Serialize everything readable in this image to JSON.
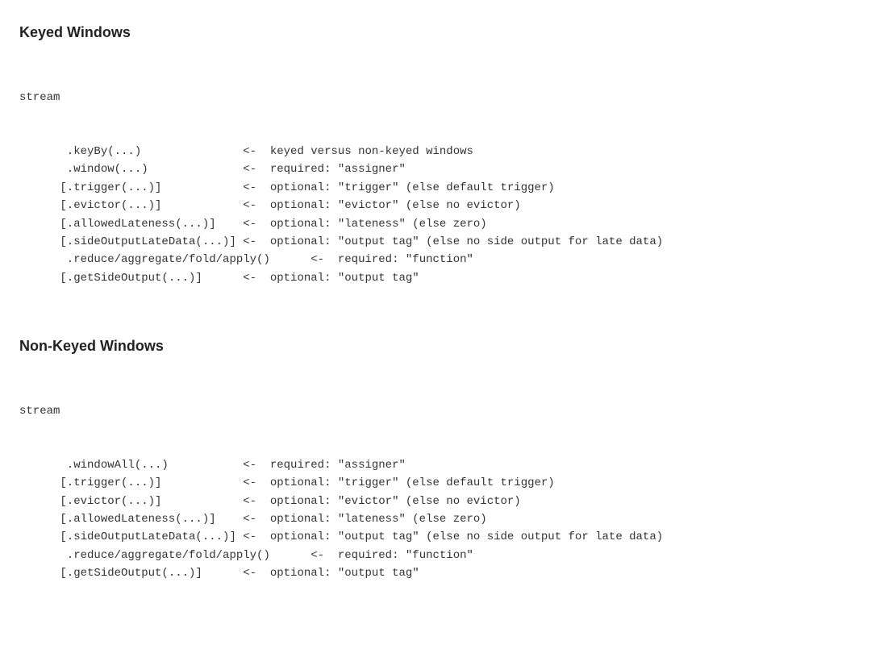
{
  "keyed": {
    "title": "Keyed Windows",
    "stream": "stream",
    "rows": [
      {
        "left": "       .keyBy(...)               ",
        "right": "<-  keyed versus non-keyed windows"
      },
      {
        "left": "       .window(...)              ",
        "right": "<-  required: \"assigner\""
      },
      {
        "left": "      [.trigger(...)]            ",
        "right": "<-  optional: \"trigger\" (else default trigger)"
      },
      {
        "left": "      [.evictor(...)]            ",
        "right": "<-  optional: \"evictor\" (else no evictor)"
      },
      {
        "left": "      [.allowedLateness(...)]    ",
        "right": "<-  optional: \"lateness\" (else zero)"
      },
      {
        "left": "      [.sideOutputLateData(...)] ",
        "right": "<-  optional: \"output tag\" (else no side output for late data)"
      },
      {
        "left": "       .reduce/aggregate/fold/apply()      ",
        "right": "<-  required: \"function\""
      },
      {
        "left": "      [.getSideOutput(...)]      ",
        "right": "<-  optional: \"output tag\""
      }
    ]
  },
  "nonkeyed": {
    "title": "Non-Keyed Windows",
    "stream": "stream",
    "rows": [
      {
        "left": "       .windowAll(...)           ",
        "right": "<-  required: \"assigner\""
      },
      {
        "left": "      [.trigger(...)]            ",
        "right": "<-  optional: \"trigger\" (else default trigger)"
      },
      {
        "left": "      [.evictor(...)]            ",
        "right": "<-  optional: \"evictor\" (else no evictor)"
      },
      {
        "left": "      [.allowedLateness(...)]    ",
        "right": "<-  optional: \"lateness\" (else zero)"
      },
      {
        "left": "      [.sideOutputLateData(...)] ",
        "right": "<-  optional: \"output tag\" (else no side output for late data)"
      },
      {
        "left": "       .reduce/aggregate/fold/apply()      ",
        "right": "<-  required: \"function\""
      },
      {
        "left": "      [.getSideOutput(...)]      ",
        "right": "<-  optional: \"output tag\""
      }
    ]
  }
}
